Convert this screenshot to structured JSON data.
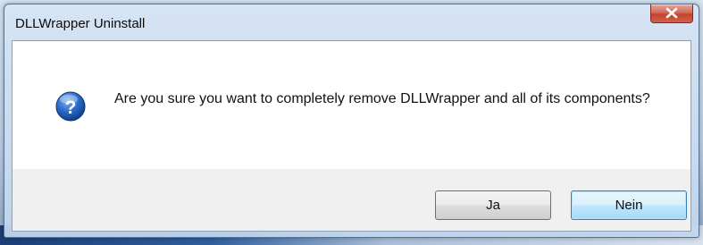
{
  "window": {
    "title": "DLLWrapper Uninstall",
    "close_glyph": "X"
  },
  "dialog": {
    "icon": "question-icon",
    "message": "Are you sure you want to completely remove DLLWrapper and all of its components?",
    "buttons": {
      "yes_label": "Ja",
      "no_label": "Nein",
      "default": "no"
    }
  },
  "colors": {
    "accent": "#3c7fb1",
    "close_button": "#c2432f",
    "icon_blue": "#1f5fb5"
  }
}
